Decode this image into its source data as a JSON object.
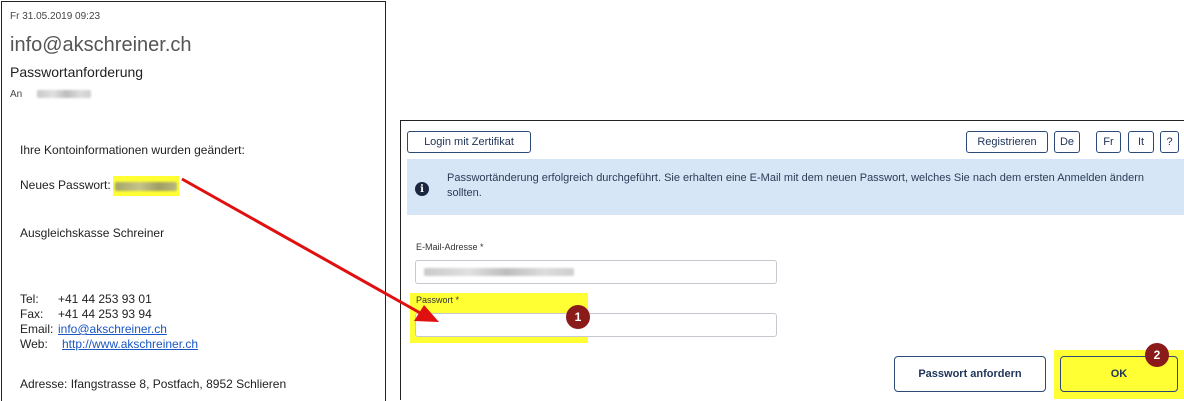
{
  "email": {
    "date": "Fr 31.05.2019 09:23",
    "sender": "info@akschreiner.ch",
    "subject": "Passwortanforderung",
    "to_label": "An",
    "line_info": "Ihre Kontoinformationen wurden geändert:",
    "new_password_label": "Neues Passwort:",
    "signature": "Ausgleichskasse Schreiner",
    "tel_label": "Tel:",
    "tel_value": "+41 44 253 93 01",
    "fax_label": "Fax:",
    "fax_value": "+41 44 253 93 94",
    "email_label": "Email:",
    "email_value": "info@akschreiner.ch",
    "web_label": "Web:",
    "web_value": "http://www.akschreiner.ch",
    "address": "Adresse: Ifangstrasse 8, Postfach, 8952 Schlieren"
  },
  "login": {
    "cert_button": "Login mit Zertifikat",
    "register_button": "Registrieren",
    "lang_de": "De",
    "lang_fr": "Fr",
    "lang_it": "It",
    "help_button": "?",
    "info_message": "Passwortänderung erfolgreich durchgeführt. Sie erhalten eine E-Mail mit dem neuen Passwort, welches Sie nach dem ersten Anmelden ändern sollten.",
    "email_label": "E-Mail-Adresse *",
    "password_label": "Passwort *",
    "request_button": "Passwort anfordern",
    "ok_button": "OK"
  },
  "annotations": {
    "step1": "1",
    "step2": "2"
  },
  "colors": {
    "highlight": "#ffff33",
    "arrow": "#e01010",
    "badge": "#8b1a1a",
    "info_bg": "#d6e6f7",
    "button_border": "#2c4a75",
    "link": "#1a57c2"
  }
}
